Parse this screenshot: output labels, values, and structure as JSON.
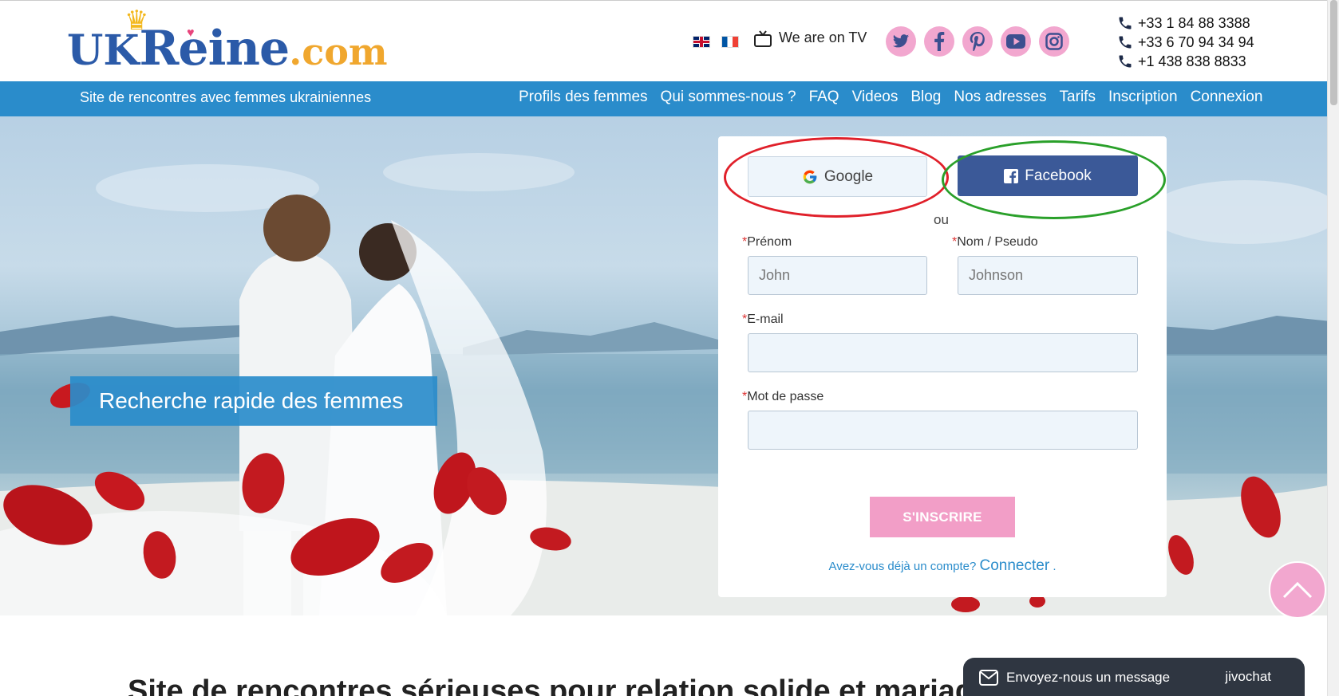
{
  "header": {
    "logo": {
      "uk": "UK",
      "reine": "Reine",
      "dotcom": ".com"
    },
    "tv_label": "We are on TV",
    "phones": [
      "+33 1 84 88 3388",
      "+33 6 70 94 34 94",
      "+1 438 838 8833"
    ],
    "socials": [
      "twitter-icon",
      "facebook-icon",
      "pinterest-icon",
      "youtube-icon",
      "instagram-icon"
    ],
    "flags": [
      "flag-uk",
      "flag-fr"
    ]
  },
  "nav": {
    "tagline": "Site de rencontres avec femmes ukrainiennes",
    "links": [
      "Profils des femmes",
      "Qui sommes-nous ?",
      "FAQ",
      "Videos",
      "Blog",
      "Nos adresses",
      "Tarifs",
      "Inscription",
      "Connexion"
    ]
  },
  "hero": {
    "search_label": "Recherche rapide des femmes"
  },
  "form": {
    "google_label": "Google",
    "facebook_label": "Facebook",
    "or_label": "ou",
    "required_mark": "*",
    "first_name_label": "Prénom",
    "first_name_placeholder": "John",
    "last_name_label": "Nom / Pseudo",
    "last_name_placeholder": "Johnson",
    "email_label": "E-mail",
    "email_value": "",
    "password_label": "Mot de passe",
    "password_value": "",
    "submit_label": "S'INSCRIRE",
    "already_text": "Avez-vous déjà un compte?",
    "connect_label": "Connecter",
    "connect_suffix": " ."
  },
  "chat": {
    "label": "Envoyez-nous un message",
    "brand": "jivochat"
  },
  "below": {
    "heading_partial": "Site de rencontres sérieuses pour relation solide et mariage"
  },
  "colors": {
    "brand_blue": "#2a8ccb",
    "facebook_blue": "#3b5998",
    "pink": "#f29ec7",
    "annotation_red": "#e0202a",
    "annotation_green": "#2aa02a"
  }
}
